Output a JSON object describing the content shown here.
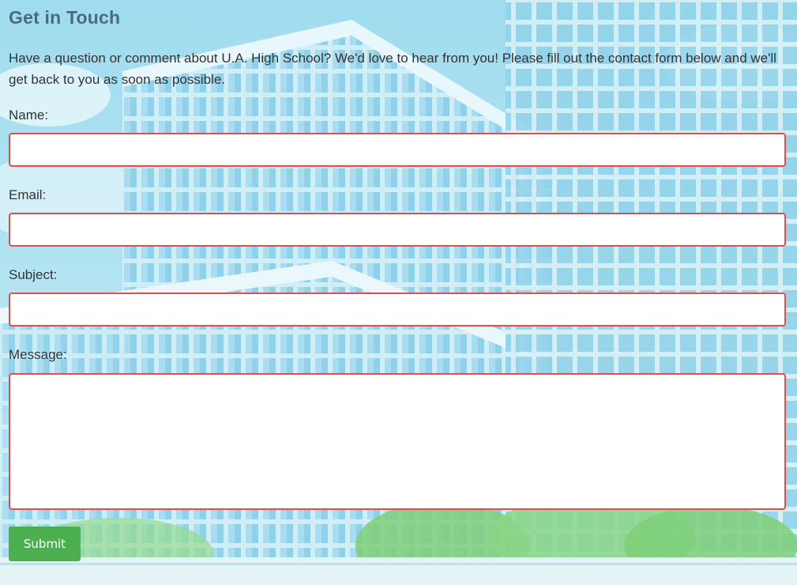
{
  "heading": "Get in Touch",
  "intro": "Have a question or comment about U.A. High School? We'd love to hear from you! Please fill out the contact form below and we'll get back to you as soon as possible.",
  "form": {
    "name_label": "Name:",
    "name_value": "",
    "email_label": "Email:",
    "email_value": "",
    "subject_label": "Subject:",
    "subject_value": "",
    "message_label": "Message:",
    "message_value": "",
    "submit_label": "Submit"
  },
  "colors": {
    "heading": "#4a6a80",
    "field_border": "#e84b4b",
    "submit_bg": "#4caf50",
    "background_sky": "#a7dff0"
  }
}
